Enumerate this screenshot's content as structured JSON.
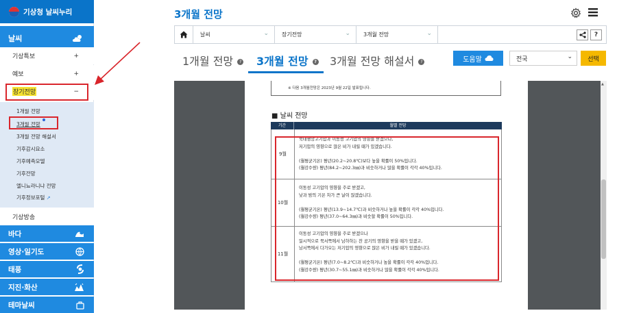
{
  "sidebar": {
    "brand": "기상청 날씨누리",
    "sections": [
      {
        "label": "날씨",
        "icon": "cloud-sun-icon"
      },
      {
        "label": "바다",
        "icon": "wave-icon"
      },
      {
        "label": "영상·일기도",
        "icon": "globe-icon"
      },
      {
        "label": "태풍",
        "icon": "typhoon-icon"
      },
      {
        "label": "지진·화산",
        "icon": "earthquake-icon"
      },
      {
        "label": "테마날씨",
        "icon": "bag-icon"
      }
    ],
    "weather_items": [
      {
        "label": "기상특보",
        "sign": "+"
      },
      {
        "label": "예보",
        "sign": "+"
      },
      {
        "label": "장기전망",
        "sign": "−"
      }
    ],
    "long_term_items": [
      "1개월 전망",
      "3개월 전망",
      "3개월 전망 해설서",
      "기후감시요소",
      "기후예측모델",
      "기후전망",
      "엘니뇨라니냐 전망",
      "기후정보포털"
    ],
    "broadcast": "기상방송"
  },
  "header": {
    "title": "3개월 전망"
  },
  "breadcrumb": [
    "날씨",
    "장기전망",
    "3개월 전망"
  ],
  "tabs": [
    "1개월 전망",
    "3개월 전망",
    "3개월 전망 해설서"
  ],
  "toolbar": {
    "help": "도움말",
    "region": "전국",
    "select": "선택"
  },
  "document": {
    "note": "※ 다음 3개월전망은 2023년 9월 22일 발표됩니다.",
    "heading": "■ 날씨 전망",
    "col_period": "기간",
    "col_outlook": "월별 전망",
    "rows": [
      {
        "month": "9월",
        "lines": [
          "북태평양고기압과 이동성 고기압의 영향을 받겠으나,",
          "저기압의 영향으로 많은 비가 내릴 때가 있겠습니다.",
          "",
          "(월평균기온) 평년(20.2~20.8℃)보다 높을 확률이 50%입니다.",
          "(월강수량) 평년(84.2~202.3㎜)과 비슷하거나 많을 확률이 각각 40%입니다."
        ]
      },
      {
        "month": "10월",
        "lines": [
          "이동성 고기압의 영향을 주로 받겠고,",
          "낮과 밤의 기온 차가 큰 날이 많겠습니다.",
          "",
          "(월평균기온) 평년(13.9~14.7℃)과 비슷하거나 높을 확률이 각각 40%입니다.",
          "(월강수량) 평년(37.0~64.3㎜)과 비슷할 확률이 50%입니다."
        ]
      },
      {
        "month": "11월",
        "lines": [
          "이동성 고기압의 영향을 주로 받겠으나",
          "일시적으로 북서쪽에서 남하하는 찬 공기의 영향을 받을 때가 있겠고,",
          "남서쪽에서 다가오는 저기압의 영향으로 많은 비가 내릴 때가 있겠습니다.",
          "",
          "(월평균기온) 평년(7.0~8.2℃)과 비슷하거나 높을 확률이 각각 40%입니다.",
          "(월강수량) 평년(30.7~55.1㎜)과 비슷하거나 많을 확률이 각각 40%입니다."
        ]
      }
    ]
  },
  "colors": {
    "primary": "#0a74c9",
    "section": "#1f8ae0",
    "highlight": "#d9252b",
    "select": "#f5b800",
    "table_header": "#1d3a5c"
  }
}
